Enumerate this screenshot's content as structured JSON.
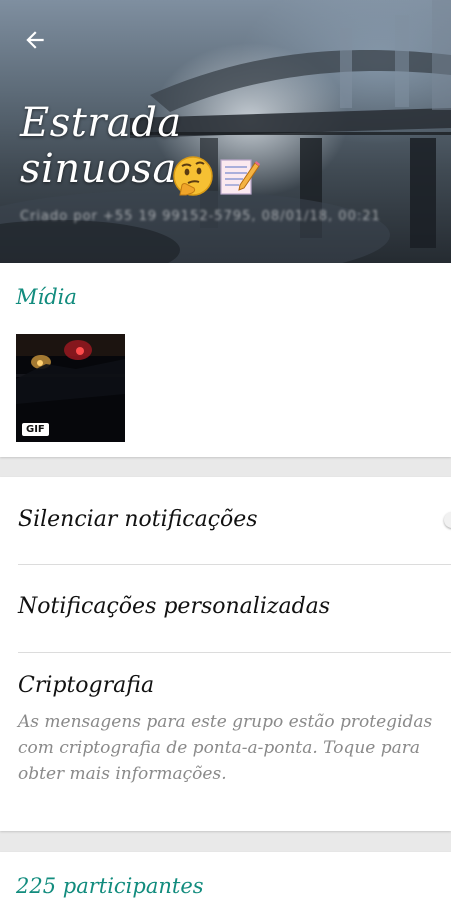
{
  "header": {
    "group_name_line1": "Estrada",
    "group_name_line2": "sinuosa",
    "emojis": [
      "thinking-face",
      "memo-pencil"
    ],
    "created_text": "Criado por +55 19 99152-5795, 08/01/18, 00:21"
  },
  "media": {
    "title": "Mídia",
    "items": [
      {
        "type": "gif",
        "badge": "GIF"
      }
    ]
  },
  "settings": {
    "mute_label": "Silenciar notificações",
    "mute_enabled": false,
    "custom_notifications_label": "Notificações personalizadas",
    "encryption_label": "Criptografia",
    "encryption_description": "As mensagens para este grupo estão protegidas com criptografia de ponta-a-ponta. Toque para obter mais informações."
  },
  "participants": {
    "title": "225 participantes"
  },
  "colors": {
    "accent": "#128c7e",
    "background": "#e9e9e9"
  },
  "icons": {
    "back": "arrow-left-icon"
  }
}
